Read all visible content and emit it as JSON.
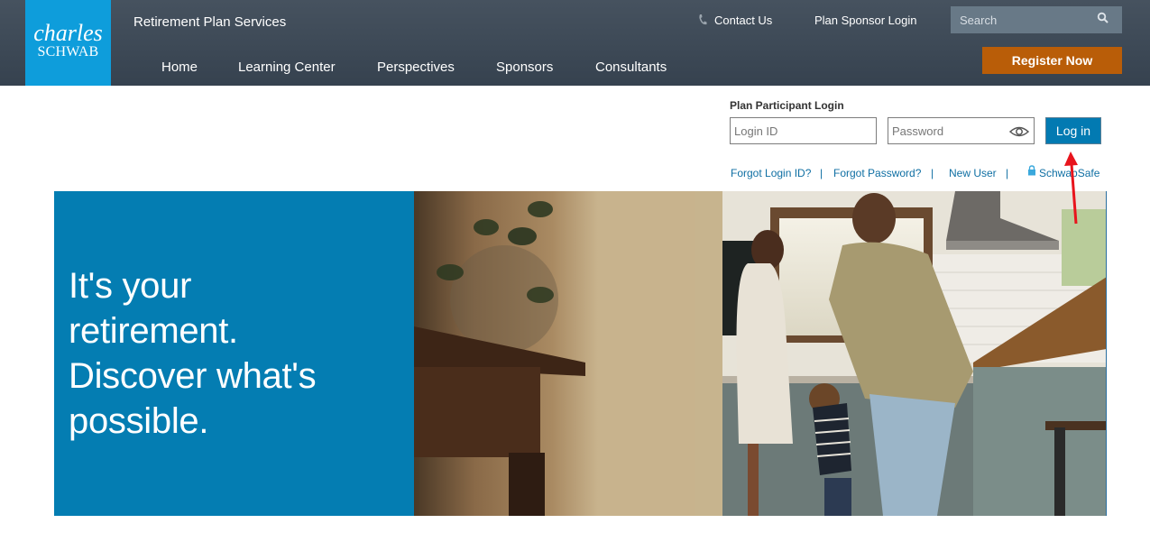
{
  "brand": {
    "logo_line1": "charles",
    "logo_line2": "SCHWAB",
    "site_title": "Retirement Plan Services",
    "colors": {
      "header_bg": "#3e4a57",
      "logo_bg": "#0e9ddb",
      "register_bg": "#b95d08",
      "hero_bg": "#047db2",
      "link": "#0f6fa3",
      "login_button": "#027ab2"
    }
  },
  "nav": {
    "items": [
      {
        "label": "Home"
      },
      {
        "label": "Learning Center"
      },
      {
        "label": "Perspectives"
      },
      {
        "label": "Sponsors"
      },
      {
        "label": "Consultants"
      }
    ]
  },
  "utility": {
    "contact_icon": "phone-icon",
    "contact_label": "Contact Us",
    "sponsor_login_label": "Plan Sponsor Login",
    "search_placeholder": "Search",
    "search_icon": "search-icon",
    "register_label": "Register Now"
  },
  "login": {
    "title": "Plan Participant Login",
    "login_id_placeholder": "Login ID",
    "password_placeholder": "Password",
    "password_toggle_icon": "eye-icon",
    "submit_label": "Log in",
    "links": [
      {
        "label": "Forgot Login ID?"
      },
      {
        "label": "Forgot Password?"
      },
      {
        "label": "New User"
      },
      {
        "label": "SchwabSafe",
        "icon": "lock-icon"
      }
    ],
    "separator": "|"
  },
  "hero": {
    "lines": [
      "It's your",
      "retirement.",
      "Discover what's",
      "possible."
    ],
    "photo_alt": "family-in-kitchen-photo"
  },
  "annotation": {
    "arrow_color": "#e8141c",
    "points_to": "Log in"
  }
}
